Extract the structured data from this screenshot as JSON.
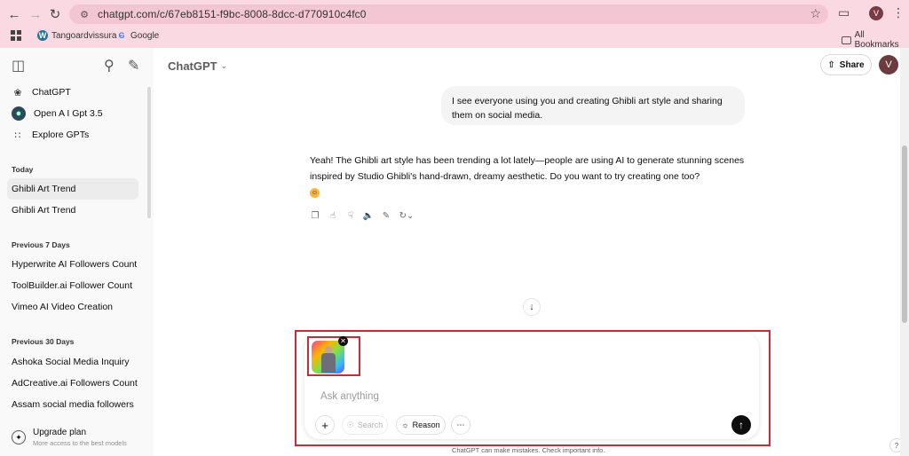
{
  "browser": {
    "url": "chatgpt.com/c/67eb8151-f9bc-8008-8dcc-d770910c4fc0",
    "profile_initial": "V",
    "bookmarks": [
      {
        "label": "Tangoardvissura -",
        "icon": "wordpress-icon"
      },
      {
        "label": "Google",
        "icon": "google-icon"
      }
    ],
    "all_bookmarks": "All Bookmarks"
  },
  "sidebar": {
    "top_items": [
      {
        "label": "ChatGPT",
        "icon": "openai-logo-icon"
      },
      {
        "label": "Open A I Gpt 3.5",
        "icon": "gpt-avatar-icon"
      },
      {
        "label": "Explore GPTs",
        "icon": "grid-icon"
      }
    ],
    "sections": [
      {
        "title": "Today",
        "items": [
          "Ghibli Art Trend",
          "Ghibli Art Trend"
        ]
      },
      {
        "title": "Previous 7 Days",
        "items": [
          "Hyperwrite AI Followers Count",
          "ToolBuilder.ai Follower Count",
          "Vimeo AI Video Creation"
        ]
      },
      {
        "title": "Previous 30 Days",
        "items": [
          "Ashoka Social Media Inquiry",
          "AdCreative.ai Followers Count",
          "Assam social media followers"
        ]
      }
    ],
    "upgrade": {
      "title": "Upgrade plan",
      "subtitle": "More access to the best models"
    }
  },
  "header": {
    "model": "ChatGPT",
    "share_label": "Share",
    "avatar_initial": "V"
  },
  "conversation": {
    "user_message": "I see everyone using you and creating Ghibli art style and sharing them on social media.",
    "assistant_message": "Yeah! The Ghibli art style has been trending a lot lately—people are using AI to generate stunning scenes inspired by Studio Ghibli's hand-drawn, dreamy aesthetic. Do you want to try creating one too?"
  },
  "composer": {
    "placeholder": "Ask anything",
    "search_label": "Search",
    "reason_label": "Reason"
  },
  "footer": {
    "disclaimer": "ChatGPT can make mistakes. Check important info.",
    "help": "?"
  },
  "colors": {
    "chrome_bg": "#fbd9e3",
    "highlight_outline": "#cc2b36",
    "send_button": "#0d0d0d"
  }
}
